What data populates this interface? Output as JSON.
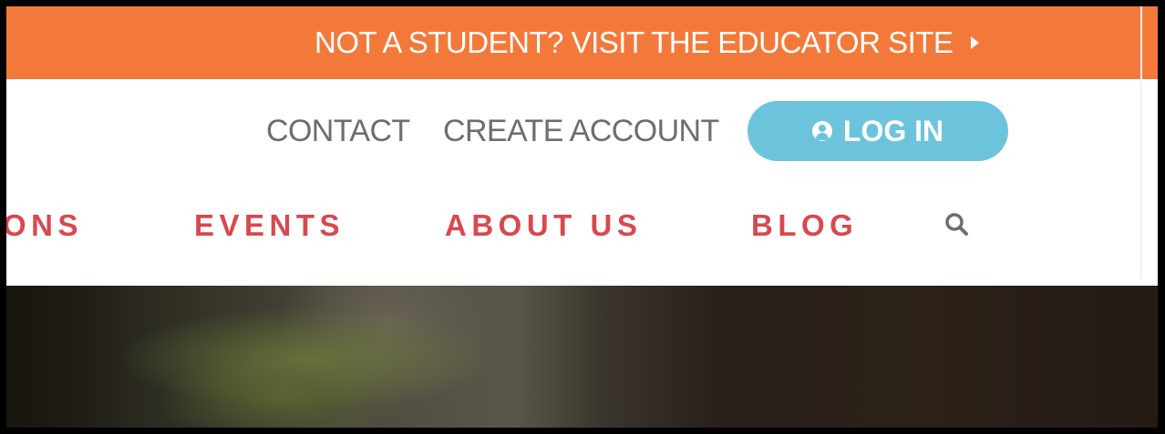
{
  "banner": {
    "text": "NOT A STUDENT? VISIT THE EDUCATOR SITE",
    "icon": "triangle-right-icon",
    "background": "#f3793a"
  },
  "utility_nav": {
    "contact": "CONTACT",
    "create_account": "CREATE ACCOUNT",
    "login": "LOG IN",
    "login_icon": "user-circle-icon",
    "login_color": "#6cc4dc"
  },
  "main_nav": {
    "items": [
      "ONS",
      "EVENTS",
      "ABOUT US",
      "BLOG"
    ],
    "search_icon": "search-icon",
    "color": "#d9484f"
  },
  "hero": {
    "description_icon": "hero-image"
  }
}
